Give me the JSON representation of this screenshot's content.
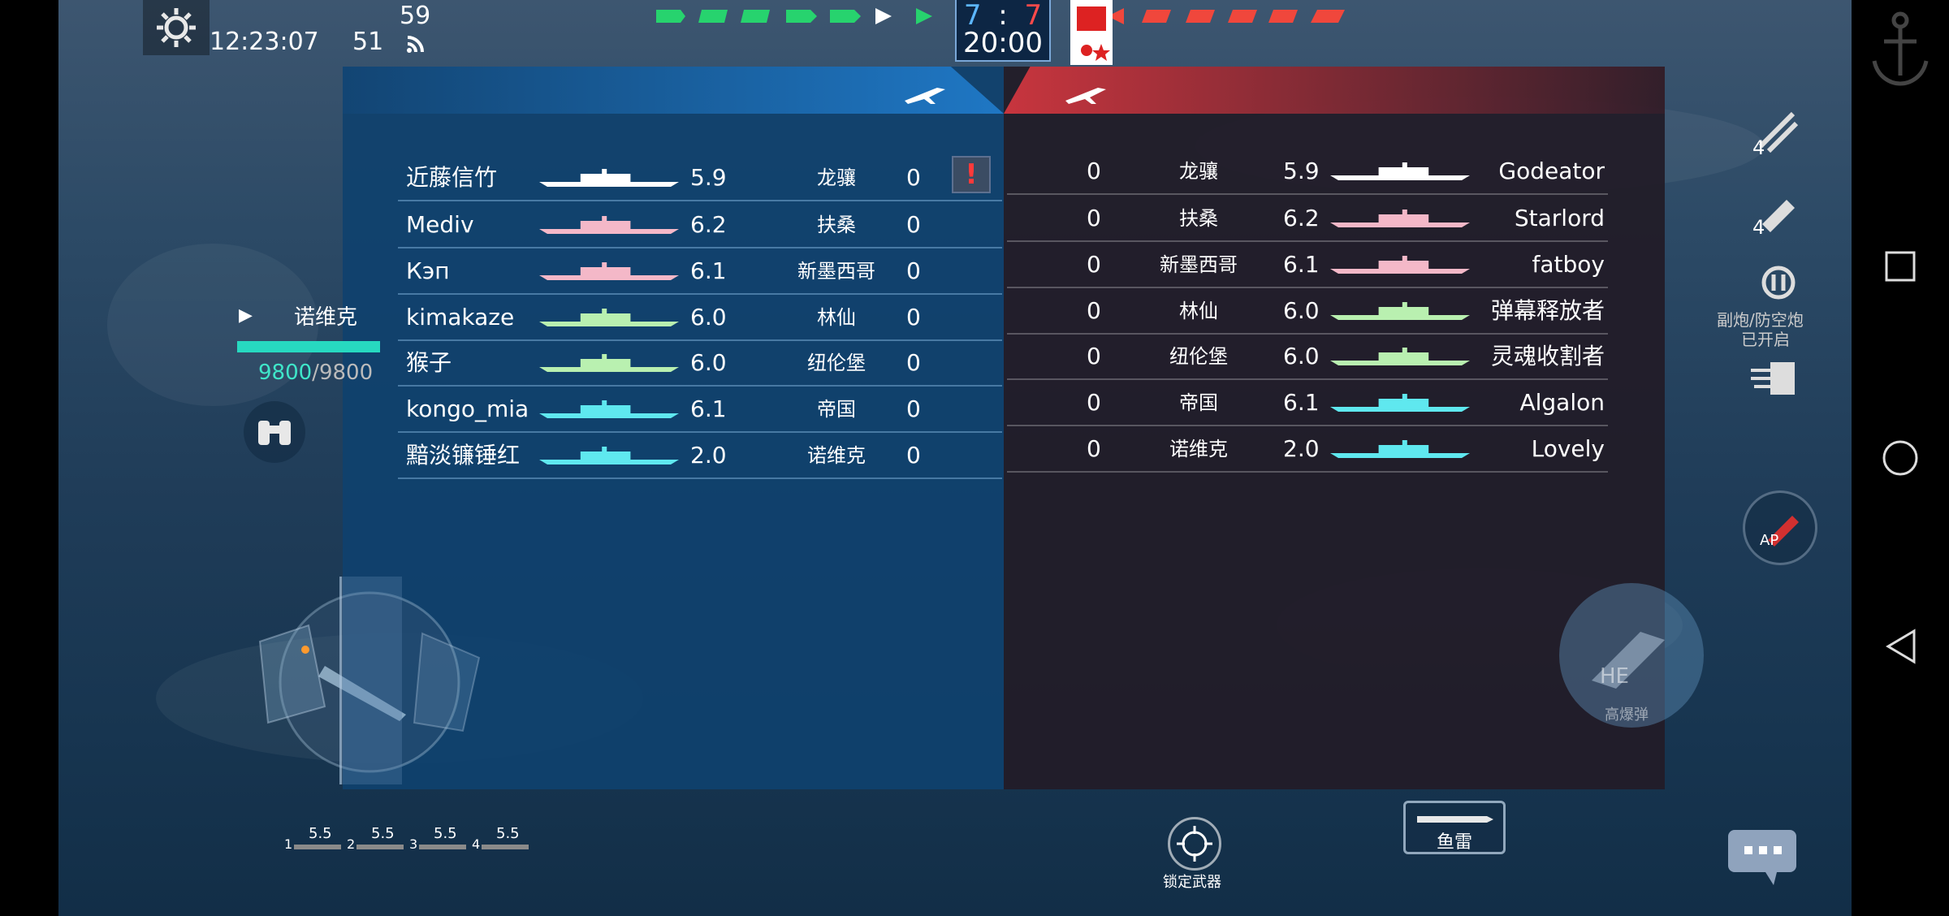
{
  "hud": {
    "time": "12:23:07",
    "ping": "51",
    "fps": "59",
    "score_left": "7",
    "score_sep": ":",
    "score_right": "7",
    "timer": "20:00"
  },
  "left_team": {
    "players": [
      {
        "name": "近藤信竹",
        "tier": "5.9",
        "ship": "龙骧",
        "score": "0",
        "color": "#ffffff"
      },
      {
        "name": "Mediv",
        "tier": "6.2",
        "ship": "扶桑",
        "score": "0",
        "color": "#f4b8c8"
      },
      {
        "name": "Кэп",
        "tier": "6.1",
        "ship": "新墨西哥",
        "score": "0",
        "color": "#f4b8c8"
      },
      {
        "name": "kimakaze",
        "tier": "6.0",
        "ship": "林仙",
        "score": "0",
        "color": "#b9f0b0"
      },
      {
        "name": "猴子",
        "tier": "6.0",
        "ship": "纽伦堡",
        "score": "0",
        "color": "#b9f0b0"
      },
      {
        "name": "kongo_mia",
        "tier": "6.1",
        "ship": "帝国",
        "score": "0",
        "color": "#5fe8ef"
      },
      {
        "name": "黯淡镰锤红",
        "tier": "2.0",
        "ship": "诺维克",
        "score": "0",
        "color": "#5fe8ef"
      }
    ]
  },
  "right_team": {
    "players": [
      {
        "name": "Godeator",
        "tier": "5.9",
        "ship": "龙骧",
        "score": "0",
        "color": "#ffffff"
      },
      {
        "name": "Starlord",
        "tier": "6.2",
        "ship": "扶桑",
        "score": "0",
        "color": "#f4b8c8"
      },
      {
        "name": "fatboy",
        "tier": "6.1",
        "ship": "新墨西哥",
        "score": "0",
        "color": "#f4b8c8"
      },
      {
        "name": "弹幕释放者",
        "tier": "6.0",
        "ship": "林仙",
        "score": "0",
        "color": "#b9f0b0"
      },
      {
        "name": "灵魂收割者",
        "tier": "6.0",
        "ship": "纽伦堡",
        "score": "0",
        "color": "#b9f0b0"
      },
      {
        "name": "Algalon",
        "tier": "6.1",
        "ship": "帝国",
        "score": "0",
        "color": "#5fe8ef"
      },
      {
        "name": "Lovely",
        "tier": "2.0",
        "ship": "诺维克",
        "score": "0",
        "color": "#5fe8ef"
      }
    ]
  },
  "warning_mark": "!",
  "player_status": {
    "ship_label": "诺维克",
    "hp_current": "9800",
    "hp_sep": "/",
    "hp_max": "9800"
  },
  "weapons": {
    "slots": [
      {
        "num": "1",
        "reload": "5.5"
      },
      {
        "num": "2",
        "reload": "5.5"
      },
      {
        "num": "3",
        "reload": "5.5"
      },
      {
        "num": "4",
        "reload": "5.5"
      }
    ],
    "lock_weapon_label": "锁定武器",
    "torpedo_label": "鱼雷",
    "ammo_ap": "AP",
    "ammo_he": "HE",
    "ammo_he_label": "高爆弹",
    "secondary_label_1": "副炮/防空炮",
    "secondary_label_2": "已开启",
    "count_1": "4",
    "count_2": "4"
  },
  "colors": {
    "friendly": "#27d36e",
    "enemy": "#f0473c",
    "score_left": "#5cb6ff",
    "score_right": "#ff4a4a"
  }
}
